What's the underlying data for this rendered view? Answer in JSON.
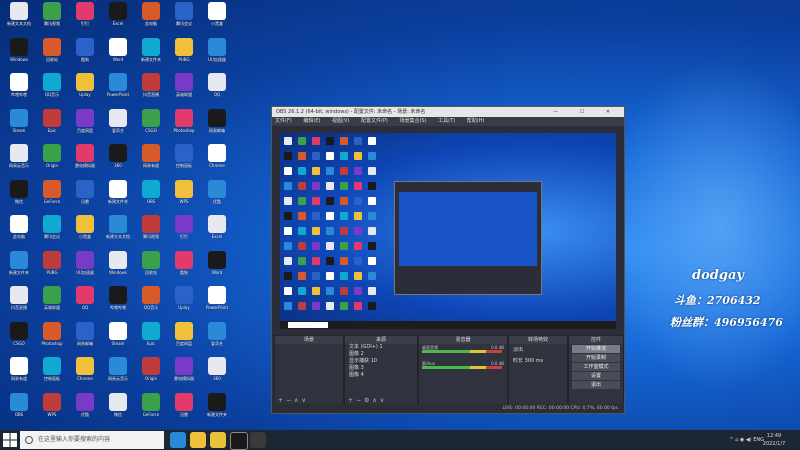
{
  "desktop_colors": [
    "#e8e8f0",
    "#2a62c9",
    "#c03b3b",
    "#1a1a1a",
    "#f0c03a",
    "#3aa04a",
    "#ffffff",
    "#7a3ac8",
    "#d85a2a",
    "#2a8ad8",
    "#e23a6a",
    "#10a9d0"
  ],
  "desktop_icons": [
    "新建文本文档",
    "Windows",
    "哔哩哔哩",
    "Steam",
    "网易云音乐",
    "微信",
    "此电脑",
    "新建文件夹",
    "抖音直播",
    "CSGO",
    "网易有道",
    "OBS",
    "腾讯视频",
    "回收站",
    "QQ音乐",
    "Epic",
    "Origin",
    "GeForce",
    "腾讯会议",
    "PUBG",
    "英雄联盟",
    "Photoshop",
    "控制面板",
    "WPS",
    "钉钉",
    "酷狗",
    "Uplay",
    "百度网盘",
    "雷电模拟器",
    "迅雷",
    "小黑盒",
    "UU加速器",
    "QQ",
    "网易邮箱",
    "Chrome",
    "优酷",
    "Excel",
    "Word",
    "PowerPoint",
    "爱奇艺",
    "360",
    "新建文件夹"
  ],
  "obs": {
    "title": "OBS 26.1.2 (64-bit, windows) - 配置文件: 未命名 - 场景: 未命名",
    "window_controls": "—  ☐  ✕",
    "menu": [
      "文件(F)",
      "编辑(E)",
      "视图(V)",
      "配置文件(P)",
      "场景集合(S)",
      "工具(T)",
      "帮助(H)"
    ],
    "docks": {
      "scenes": "场景",
      "sources": "来源",
      "mixer": "混音器",
      "transitions": "转场特效",
      "controls": "控件"
    },
    "sources": [
      "文本 (GDI+) 1",
      "图像 2",
      "显示捕获 10",
      "图像 3",
      "图像 4"
    ],
    "mixer": [
      {
        "label": "桌面音频",
        "value": "0.0 dB"
      },
      {
        "label": "麦/Aux",
        "value": "0.0 dB"
      }
    ],
    "transitions": {
      "type": "淡出",
      "duration_label": "时长",
      "duration_value": "300 ms"
    },
    "controls": [
      "开始推流",
      "开始录制",
      "工作室模式",
      "设置",
      "退出"
    ],
    "status": "LIVE: 00:00:00   REC: 00:00:00   CPU: 0.7%, 60.00 fps"
  },
  "overlay": {
    "name": "dodgay",
    "fan_group_label": "斗鱼：",
    "fan_group": "2706432",
    "group_label": "粉丝群：",
    "group": "496956476"
  },
  "taskbar": {
    "search_placeholder": "在这里输入你要搜索的内容",
    "tray_lang": "ENG",
    "tray_icons": "^  ⌂  ◉  ◀)",
    "time": "12:49",
    "date": "2022/1/7"
  },
  "colors": {
    "accent": "#1667d6",
    "obs_bg": "#2b2e38",
    "taskbar": "#1d2633"
  }
}
